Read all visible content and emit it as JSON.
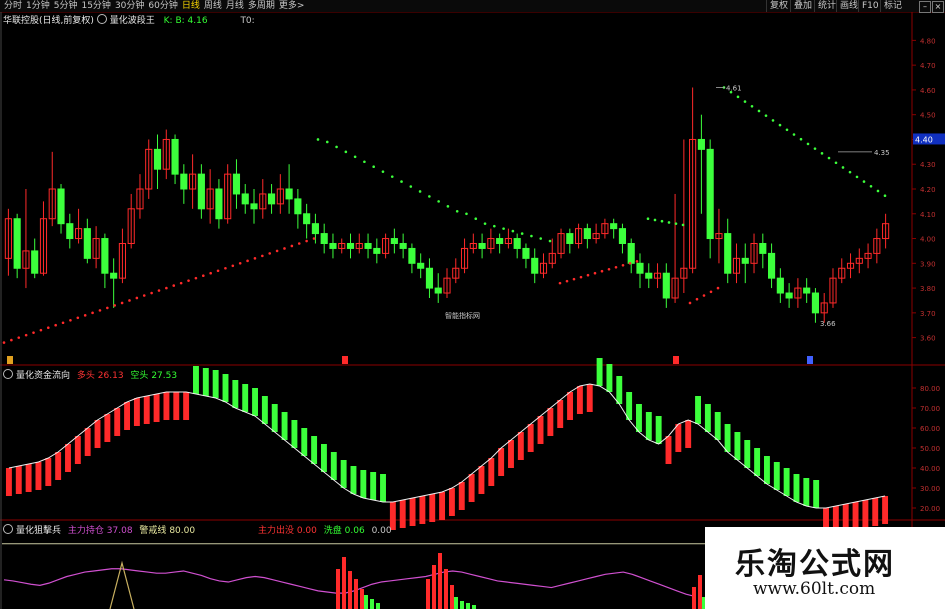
{
  "toolbar": {
    "timeframes": [
      "分时",
      "1分钟",
      "5分钟",
      "15分钟",
      "30分钟",
      "60分钟",
      "日线",
      "周线",
      "月线",
      "多周期",
      "更多>"
    ],
    "active_timeframe": "日线",
    "right_buttons": [
      "复权",
      "叠加",
      "统计",
      "画线",
      "F10",
      "标记"
    ]
  },
  "main_panel": {
    "stock_name": "华联控股(日线,前复权)",
    "indicator_name": "量化波段王",
    "indicator_values": "K: B: 4.16",
    "t0_label": "T0:",
    "watermark_text": "智能指标网",
    "price_tag": "4.40",
    "annotation_high": "4.35",
    "annotation_low": "3.66",
    "annotation_peak": "4.61"
  },
  "sub_panel1": {
    "title": "量化资金流向",
    "long_label": "多头",
    "long_value": "26.13",
    "short_label": "空头",
    "short_value": "27.53"
  },
  "sub_panel2": {
    "title": "量化狙擊兵",
    "item1_label": "主力持仓",
    "item1_value": "37.08",
    "item2_label": "警戒线",
    "item2_value": "80.00",
    "item3_label": "主力出没",
    "item3_value": "0.00",
    "item4_label": "洗盘",
    "item4_value": "0.06",
    "item5_value": "0.00"
  },
  "site_watermark": {
    "name": "乐淘公式网",
    "url": "www.60lt.com"
  },
  "colors": {
    "up": "#ff2a2a",
    "down": "#3cff3c",
    "axis": "#8b0000",
    "magenta": "#d050d0",
    "olive": "#c8b060"
  },
  "chart_data": [
    {
      "type": "candlestick",
      "name": "price",
      "yticks": [
        3.6,
        3.7,
        3.8,
        3.9,
        4.0,
        4.1,
        4.2,
        4.3,
        4.4,
        4.5,
        4.6,
        4.7,
        4.8
      ],
      "ylim": [
        3.55,
        4.85
      ],
      "candles": [
        [
          3.92,
          4.08,
          3.85,
          4.12
        ],
        [
          4.08,
          3.88,
          3.84,
          4.1
        ],
        [
          3.88,
          3.95,
          3.8,
          4.2
        ],
        [
          3.95,
          3.86,
          3.84,
          4.0
        ],
        [
          3.86,
          4.08,
          3.85,
          4.15
        ],
        [
          4.08,
          4.2,
          4.05,
          4.35
        ],
        [
          4.2,
          4.06,
          4.02,
          4.22
        ],
        [
          4.06,
          4.0,
          3.96,
          4.1
        ],
        [
          4.0,
          4.04,
          3.98,
          4.12
        ],
        [
          4.04,
          3.92,
          3.9,
          4.08
        ],
        [
          3.92,
          4.0,
          3.88,
          4.05
        ],
        [
          4.0,
          3.86,
          3.8,
          4.02
        ],
        [
          3.86,
          3.84,
          3.72,
          3.92
        ],
        [
          3.84,
          3.98,
          3.82,
          4.04
        ],
        [
          3.98,
          4.12,
          3.96,
          4.18
        ],
        [
          4.12,
          4.2,
          4.08,
          4.26
        ],
        [
          4.2,
          4.36,
          4.16,
          4.4
        ],
        [
          4.36,
          4.28,
          4.2,
          4.42
        ],
        [
          4.28,
          4.4,
          4.24,
          4.44
        ],
        [
          4.4,
          4.26,
          4.22,
          4.42
        ],
        [
          4.26,
          4.2,
          4.14,
          4.3
        ],
        [
          4.2,
          4.26,
          4.12,
          4.34
        ],
        [
          4.26,
          4.12,
          4.08,
          4.3
        ],
        [
          4.12,
          4.2,
          4.06,
          4.28
        ],
        [
          4.2,
          4.08,
          4.04,
          4.24
        ],
        [
          4.08,
          4.26,
          4.06,
          4.3
        ],
        [
          4.26,
          4.18,
          4.12,
          4.32
        ],
        [
          4.18,
          4.14,
          4.1,
          4.22
        ],
        [
          4.14,
          4.12,
          4.06,
          4.2
        ],
        [
          4.12,
          4.18,
          4.08,
          4.24
        ],
        [
          4.18,
          4.14,
          4.1,
          4.22
        ],
        [
          4.14,
          4.2,
          4.1,
          4.26
        ],
        [
          4.2,
          4.16,
          4.1,
          4.3
        ],
        [
          4.16,
          4.1,
          4.04,
          4.2
        ],
        [
          4.1,
          4.06,
          4.0,
          4.14
        ],
        [
          4.06,
          4.02,
          3.98,
          4.1
        ],
        [
          4.02,
          3.98,
          3.94,
          4.06
        ],
        [
          3.98,
          3.96,
          3.92,
          4.02
        ],
        [
          3.96,
          3.98,
          3.94,
          4.0
        ],
        [
          3.98,
          3.96,
          3.92,
          4.02
        ],
        [
          3.96,
          3.98,
          3.94,
          4.02
        ],
        [
          3.98,
          3.96,
          3.92,
          4.02
        ],
        [
          3.96,
          3.94,
          3.9,
          4.0
        ],
        [
          3.94,
          4.0,
          3.92,
          4.02
        ],
        [
          4.0,
          3.98,
          3.94,
          4.04
        ],
        [
          3.98,
          3.96,
          3.92,
          4.02
        ],
        [
          3.96,
          3.9,
          3.86,
          3.98
        ],
        [
          3.9,
          3.88,
          3.84,
          3.94
        ],
        [
          3.88,
          3.8,
          3.76,
          3.92
        ],
        [
          3.8,
          3.78,
          3.74,
          3.86
        ],
        [
          3.78,
          3.84,
          3.76,
          3.88
        ],
        [
          3.84,
          3.88,
          3.82,
          3.92
        ],
        [
          3.88,
          3.96,
          3.86,
          4.0
        ],
        [
          3.96,
          3.98,
          3.94,
          4.02
        ],
        [
          3.98,
          3.96,
          3.92,
          4.02
        ],
        [
          3.96,
          4.0,
          3.94,
          4.04
        ],
        [
          4.0,
          3.98,
          3.94,
          4.02
        ],
        [
          3.98,
          4.0,
          3.96,
          4.04
        ],
        [
          4.0,
          3.96,
          3.92,
          4.02
        ],
        [
          3.96,
          3.92,
          3.88,
          3.98
        ],
        [
          3.92,
          3.86,
          3.82,
          3.96
        ],
        [
          3.86,
          3.9,
          3.84,
          3.94
        ],
        [
          3.9,
          3.94,
          3.88,
          4.0
        ],
        [
          3.94,
          4.02,
          3.92,
          4.04
        ],
        [
          4.02,
          3.98,
          3.94,
          4.04
        ],
        [
          3.98,
          4.04,
          3.96,
          4.06
        ],
        [
          4.04,
          4.0,
          3.96,
          4.06
        ],
        [
          4.0,
          4.02,
          3.98,
          4.06
        ],
        [
          4.02,
          4.06,
          4.0,
          4.08
        ],
        [
          4.06,
          4.04,
          4.0,
          4.08
        ],
        [
          4.04,
          3.98,
          3.94,
          4.06
        ],
        [
          3.98,
          3.9,
          3.86,
          4.0
        ],
        [
          3.9,
          3.86,
          3.8,
          3.94
        ],
        [
          3.86,
          3.84,
          3.8,
          3.9
        ],
        [
          3.84,
          3.86,
          3.8,
          3.9
        ],
        [
          3.86,
          3.76,
          3.72,
          3.9
        ],
        [
          3.76,
          3.84,
          3.74,
          4.18
        ],
        [
          3.84,
          3.88,
          3.78,
          4.4
        ],
        [
          3.88,
          4.4,
          3.86,
          4.61
        ],
        [
          4.4,
          4.36,
          4.1,
          4.5
        ],
        [
          4.36,
          4.0,
          3.92,
          4.4
        ],
        [
          4.0,
          4.02,
          3.9,
          4.12
        ],
        [
          4.02,
          3.86,
          3.82,
          4.08
        ],
        [
          3.86,
          3.92,
          3.82,
          3.98
        ],
        [
          3.92,
          3.9,
          3.82,
          3.98
        ],
        [
          3.9,
          3.98,
          3.86,
          4.02
        ],
        [
          3.98,
          3.94,
          3.88,
          4.02
        ],
        [
          3.94,
          3.84,
          3.8,
          3.98
        ],
        [
          3.84,
          3.78,
          3.74,
          3.88
        ],
        [
          3.78,
          3.76,
          3.72,
          3.82
        ],
        [
          3.76,
          3.8,
          3.72,
          3.84
        ],
        [
          3.8,
          3.78,
          3.74,
          3.84
        ],
        [
          3.78,
          3.7,
          3.66,
          3.8
        ],
        [
          3.7,
          3.74,
          3.66,
          3.78
        ],
        [
          3.74,
          3.84,
          3.72,
          3.88
        ],
        [
          3.84,
          3.88,
          3.82,
          3.92
        ],
        [
          3.88,
          3.9,
          3.84,
          3.94
        ],
        [
          3.9,
          3.92,
          3.86,
          3.96
        ],
        [
          3.92,
          3.94,
          3.88,
          3.98
        ],
        [
          3.94,
          4.0,
          3.9,
          4.04
        ],
        [
          4.0,
          4.06,
          3.96,
          4.1
        ]
      ],
      "support_line": [
        3.58,
        3.59,
        3.6,
        3.61,
        3.62,
        3.63,
        3.64,
        3.65,
        3.66,
        3.67,
        3.68,
        3.69,
        3.7,
        3.71,
        3.72,
        3.73,
        3.74,
        3.75,
        3.76,
        3.77,
        3.78,
        3.79,
        3.8,
        3.81,
        3.82,
        3.83,
        3.84,
        3.85,
        3.86,
        3.87,
        3.88,
        3.89,
        3.9,
        3.91,
        3.92,
        3.93,
        3.94,
        3.95,
        3.96,
        3.97,
        3.98,
        3.99,
        4.0
      ],
      "resistance_line": [
        4.4,
        4.39,
        4.37,
        4.35,
        4.33,
        4.31,
        4.29,
        4.27,
        4.25,
        4.23,
        4.21,
        4.19,
        4.17,
        4.15,
        4.13,
        4.11,
        4.1,
        4.08,
        4.06,
        4.05,
        4.04,
        4.03,
        4.02,
        4.01,
        4.0,
        3.99
      ]
    },
    {
      "type": "bar",
      "name": "量化资金流向",
      "yticks": [
        20.0,
        30.0,
        40.0,
        50.0,
        60.0,
        70.0,
        80.0
      ],
      "ylim": [
        15,
        85
      ],
      "baseline": 44,
      "values": [
        40,
        41,
        42,
        43,
        45,
        48,
        52,
        56,
        60,
        64,
        67,
        70,
        73,
        75,
        76,
        77,
        78,
        78,
        78,
        77,
        76,
        75,
        73,
        70,
        68,
        66,
        62,
        58,
        54,
        50,
        46,
        42,
        38,
        34,
        30,
        27,
        25,
        24,
        23,
        23,
        24,
        25,
        26,
        27,
        28,
        30,
        33,
        37,
        41,
        45,
        50,
        54,
        58,
        62,
        66,
        70,
        74,
        78,
        81,
        82,
        81,
        78,
        72,
        64,
        58,
        54,
        52,
        56,
        62,
        64,
        62,
        58,
        54,
        48,
        44,
        40,
        36,
        32,
        29,
        26,
        23,
        21,
        20,
        20,
        21,
        22,
        23,
        24,
        25,
        26
      ]
    },
    {
      "type": "line",
      "name": "量化狙擊兵",
      "ylim": [
        0,
        100
      ],
      "warning_line": 80,
      "main_position": [
        60,
        58,
        55,
        52,
        50,
        54,
        60,
        66,
        70,
        74,
        76,
        78,
        80,
        80,
        78,
        76,
        74,
        72,
        72,
        74,
        76,
        72,
        68,
        62,
        58,
        56,
        60,
        64,
        66,
        64,
        60,
        56,
        52,
        48,
        44,
        40,
        38,
        36,
        36,
        40,
        46,
        52,
        56,
        58,
        60,
        62,
        64,
        66,
        70,
        74,
        76,
        74,
        70,
        66,
        62,
        58,
        56,
        54,
        52,
        50,
        48,
        46,
        50,
        54,
        58,
        62,
        66,
        70,
        72,
        74,
        70,
        64,
        58,
        52,
        46,
        40,
        34,
        30
      ]
    }
  ]
}
